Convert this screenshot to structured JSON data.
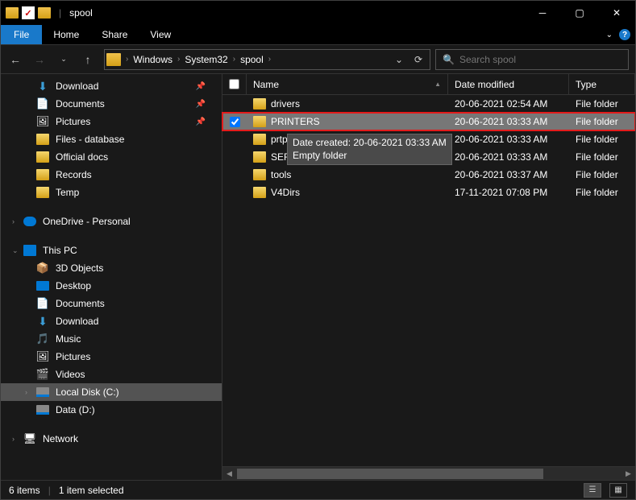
{
  "title": "spool",
  "ribbon": {
    "file": "File",
    "home": "Home",
    "share": "Share",
    "view": "View"
  },
  "breadcrumbs": [
    "Windows",
    "System32",
    "spool"
  ],
  "search": {
    "placeholder": "Search spool"
  },
  "navpane": {
    "quick": [
      {
        "label": "Download",
        "icon": "download",
        "pinned": true
      },
      {
        "label": "Documents",
        "icon": "doc",
        "pinned": true
      },
      {
        "label": "Pictures",
        "icon": "pic",
        "pinned": true
      },
      {
        "label": "Files - database",
        "icon": "folder"
      },
      {
        "label": "Official docs",
        "icon": "folder"
      },
      {
        "label": "Records",
        "icon": "folder"
      },
      {
        "label": "Temp",
        "icon": "folder"
      }
    ],
    "onedrive": "OneDrive - Personal",
    "thispc": "This PC",
    "thispc_children": [
      {
        "label": "3D Objects",
        "icon": "3d"
      },
      {
        "label": "Desktop",
        "icon": "desktop"
      },
      {
        "label": "Documents",
        "icon": "doc"
      },
      {
        "label": "Download",
        "icon": "download"
      },
      {
        "label": "Music",
        "icon": "music"
      },
      {
        "label": "Pictures",
        "icon": "pic"
      },
      {
        "label": "Videos",
        "icon": "video"
      },
      {
        "label": "Local Disk (C:)",
        "icon": "disk",
        "selected": true
      },
      {
        "label": "Data (D:)",
        "icon": "disk"
      }
    ],
    "network": "Network"
  },
  "columns": {
    "name": "Name",
    "date": "Date modified",
    "type": "Type"
  },
  "rows": [
    {
      "name": "drivers",
      "date": "20-06-2021 02:54 AM",
      "type": "File folder",
      "selected": false
    },
    {
      "name": "PRINTERS",
      "date": "20-06-2021 03:33 AM",
      "type": "File folder",
      "selected": true
    },
    {
      "name": "prtprocs",
      "date": "20-06-2021 03:33 AM",
      "type": "File folder",
      "selected": false
    },
    {
      "name": "SERVERS",
      "date": "20-06-2021 03:33 AM",
      "type": "File folder",
      "selected": false
    },
    {
      "name": "tools",
      "date": "20-06-2021 03:37 AM",
      "type": "File folder",
      "selected": false
    },
    {
      "name": "V4Dirs",
      "date": "17-11-2021 07:08 PM",
      "type": "File folder",
      "selected": false
    }
  ],
  "tooltip": {
    "line1": "Date created: 20-06-2021 03:33 AM",
    "line2": "Empty folder"
  },
  "status": {
    "count": "6 items",
    "selected": "1 item selected"
  }
}
